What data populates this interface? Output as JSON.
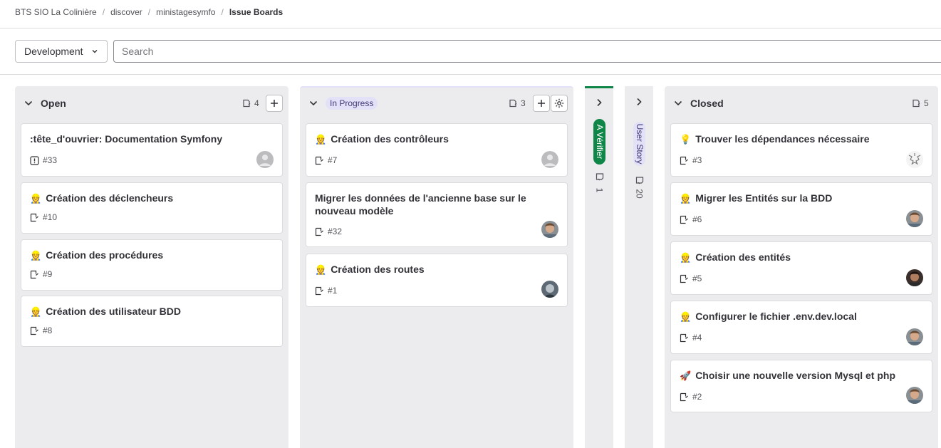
{
  "breadcrumb": {
    "items": [
      "BTS SIO La Colinière",
      "discover",
      "ministagesymfo"
    ],
    "current": "Issue Boards"
  },
  "filters": {
    "board_select": "Development",
    "search_placeholder": "Search"
  },
  "lists": {
    "open": {
      "title": "Open",
      "count": "4",
      "cards": [
        {
          "title": ":tête_d'ouvrier: Documentation Symfony",
          "ref": "#33",
          "icon": "issue-icon",
          "avatar": "default"
        },
        {
          "emoji": "👷",
          "title": "Création des déclencheurs",
          "ref": "#10",
          "icon": "task-icon"
        },
        {
          "emoji": "👷",
          "title": "Création des procédures",
          "ref": "#9",
          "icon": "task-icon"
        },
        {
          "emoji": "👷",
          "title": "Création des utilisateur BDD",
          "ref": "#8",
          "icon": "task-icon"
        }
      ]
    },
    "in_progress": {
      "label": "In Progress",
      "count": "3",
      "cards": [
        {
          "emoji": "👷",
          "title": "Création des contrôleurs",
          "ref": "#7",
          "icon": "task-icon",
          "avatar": "default"
        },
        {
          "title": "Migrer les données de l'ancienne base sur le nouveau modèle",
          "ref": "#32",
          "icon": "task-icon",
          "avatar": "user-a"
        },
        {
          "emoji": "👷",
          "title": "Création des routes",
          "ref": "#1",
          "icon": "task-icon",
          "avatar": "user-b"
        }
      ]
    },
    "a_verifier": {
      "label": "A Vérifier",
      "count": "1"
    },
    "user_story": {
      "label": "User Story",
      "count": "20"
    },
    "closed": {
      "title": "Closed",
      "count": "5",
      "cards": [
        {
          "emoji": "💡",
          "title": "Trouver les dépendances nécessaire",
          "ref": "#3",
          "icon": "task-icon",
          "avatar": "identicon"
        },
        {
          "emoji": "👷",
          "title": "Migrer les Entités sur la BDD",
          "ref": "#6",
          "icon": "task-icon",
          "avatar": "user-a"
        },
        {
          "emoji": "👷",
          "title": "Création des entités",
          "ref": "#5",
          "icon": "task-icon",
          "avatar": "user-c"
        },
        {
          "emoji": "👷",
          "title": "Configurer le fichier .env.dev.local",
          "ref": "#4",
          "icon": "task-icon",
          "avatar": "user-a"
        },
        {
          "emoji": "🚀",
          "title": "Choisir une nouvelle version Mysql et php",
          "ref": "#2",
          "icon": "task-icon",
          "avatar": "user-a"
        }
      ]
    }
  },
  "colors": {
    "list_bg": "#ececef",
    "accent_green": "#108548",
    "label_purple": "#e3e1f7"
  }
}
